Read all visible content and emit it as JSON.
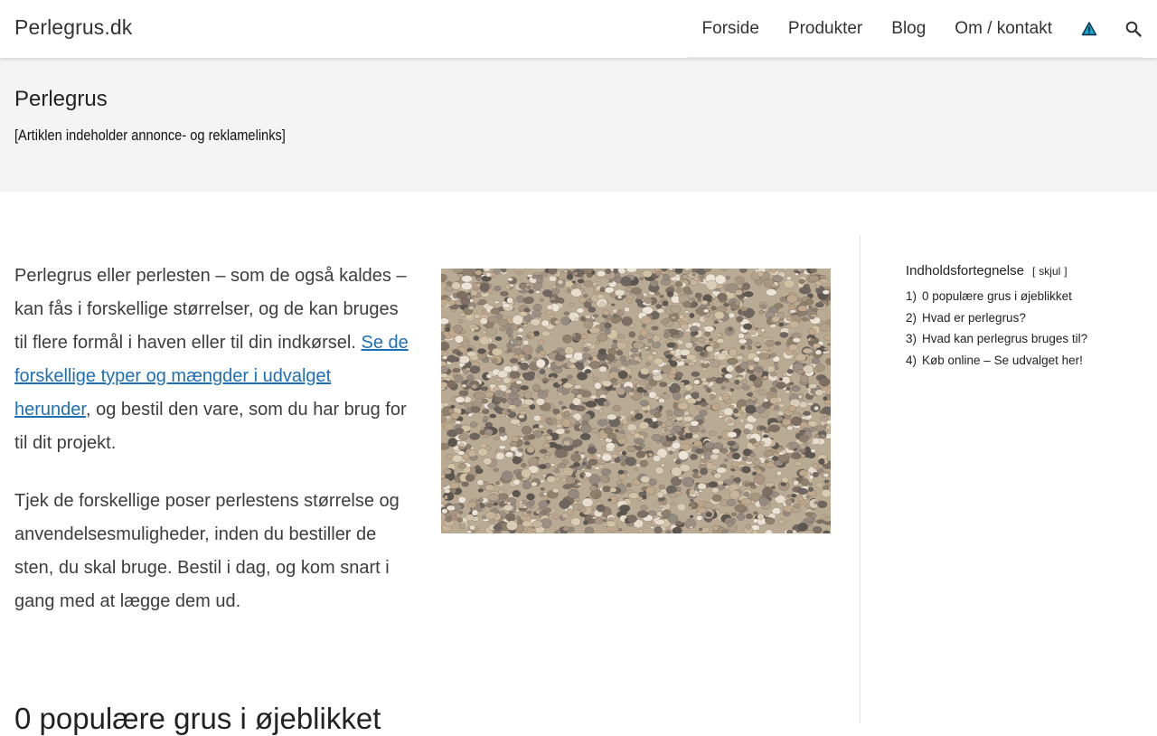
{
  "header": {
    "site_title": "Perlegrus.dk",
    "nav": [
      {
        "label": "Forside"
      },
      {
        "label": "Produkter"
      },
      {
        "label": "Blog"
      },
      {
        "label": "Om / kontakt"
      }
    ],
    "icons": [
      "warning-icon",
      "search-icon"
    ],
    "accent_color": "#1f6fb5"
  },
  "title_band": {
    "title": "Perlegrus",
    "notice": "[Artiklen indeholder annonce- og reklamelinks]"
  },
  "main": {
    "para1_text": "Perlegrus eller perlesten – som de også kaldes – kan fås i forskellige størrelser, og de kan bruges til flere formål i haven eller til din indkørsel. ",
    "para1_link": "Se de forskellige typer og mængder i udvalget herunder",
    "para1_after": ", og bestil den vare, som du har brug for til dit projekt.",
    "para2": "Tjek de forskellige poser perlestens størrelse og anvendelsesmuligheder, inden du bestiller de sten, du skal bruge. Bestil i dag, og kom snart i gang med at lægge dem ud.",
    "image_label": "gravel-image",
    "section_heading": "0 populære grus i øjeblikket"
  },
  "toc": {
    "title": "Indholdsfortegnelse",
    "toggle_open": "[",
    "toggle_label": "skjul",
    "toggle_close": "]",
    "items": [
      {
        "num": "1)",
        "label": "0 populære grus i øjeblikket"
      },
      {
        "num": "2)",
        "label": "Hvad er perlegrus?"
      },
      {
        "num": "3)",
        "label": "Hvad kan perlegrus bruges til?"
      },
      {
        "num": "4)",
        "label": "Køb online – Se udvalget her!"
      }
    ]
  }
}
